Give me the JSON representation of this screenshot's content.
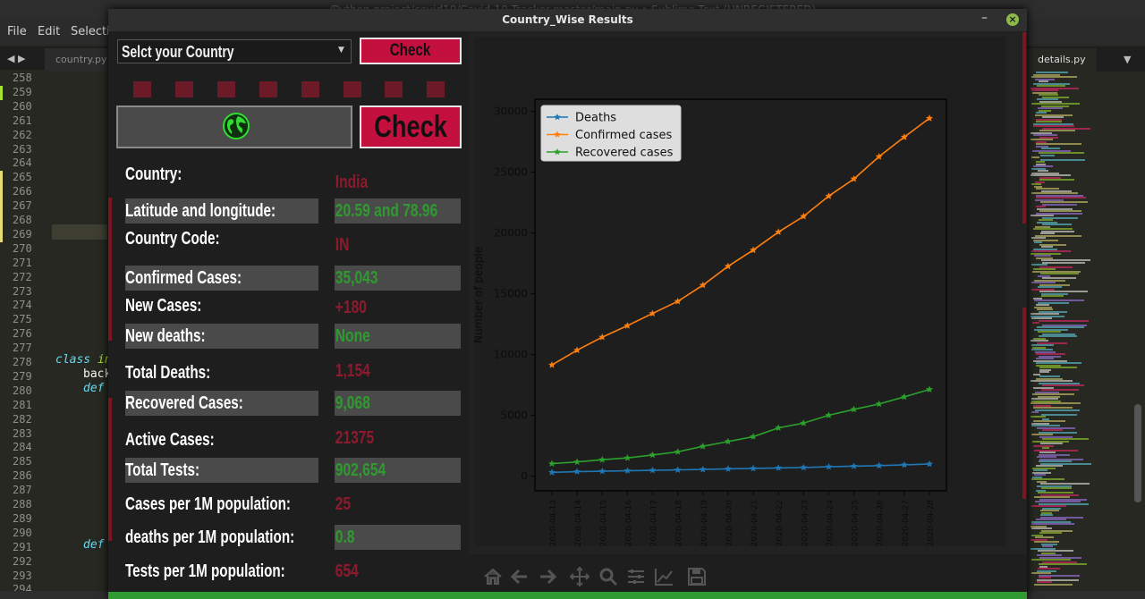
{
  "editor": {
    "title": "/Python project/covid19/Covid-19 Tracker-master/main.py • Sublime Text (UNREGISTERED)",
    "menu": [
      "File",
      "Edit",
      "Selection"
    ],
    "tabs": {
      "left": "country.py",
      "right": "details.py"
    },
    "line_numbers": [
      "258",
      "259",
      "260",
      "261",
      "262",
      "263",
      "264",
      "265",
      "266",
      "267",
      "268",
      "269",
      "270",
      "271",
      "272",
      "273",
      "274",
      "275",
      "276",
      "277",
      "278",
      "279",
      "280",
      "281",
      "282",
      "283",
      "284",
      "285",
      "286",
      "287",
      "288",
      "289",
      "290",
      "291",
      "292",
      "293",
      "294"
    ],
    "code_snippets": {
      "class_kw": "class ",
      "class_rest": "in",
      "back": "back",
      "def1": "def",
      "def2": "def"
    }
  },
  "window": {
    "title": "Country_Wise Results",
    "minimize": "–",
    "close": "×"
  },
  "controls": {
    "select_label": "Selct your Country",
    "check_small": "Check",
    "check_big": "Check"
  },
  "stats": {
    "country_label": "Country:",
    "country_value": "India",
    "latlon_label": "Latitude and longitude:",
    "latlon_value": "20.59 and 78.96",
    "code_label": "Country Code:",
    "code_value": "IN",
    "confirmed_label": "Confirmed Cases:",
    "confirmed_value": "35,043",
    "new_cases_label": "New Cases:",
    "new_cases_value": "+180",
    "new_deaths_label": "New deaths:",
    "new_deaths_value": "None",
    "total_deaths_label": "Total Deaths:",
    "total_deaths_value": "1,154",
    "recovered_label": "Recovered Cases:",
    "recovered_value": "9,068",
    "active_label": "Active Cases:",
    "active_value": "21375",
    "tests_label": "Total Tests:",
    "tests_value": "902,654",
    "cases_per_m_label": "Cases per 1M population:",
    "cases_per_m_value": "25",
    "deaths_per_m_label": "deaths per 1M population:",
    "deaths_per_m_value": "0.8",
    "tests_per_m_label": "Tests per 1M population:",
    "tests_per_m_value": "654"
  },
  "colors": {
    "accent_red": "#c4103f",
    "value_red": "#8e1a2e",
    "value_green": "#2f9a2f",
    "deaths": "#1f77b4",
    "confirmed": "#ff7f0e",
    "recovered": "#2ca02c"
  },
  "toolbar_icons": [
    "home-icon",
    "back-icon",
    "forward-icon",
    "pan-icon",
    "zoom-icon",
    "subplots-icon",
    "edit-axis-icon",
    "save-icon"
  ],
  "chart_data": {
    "type": "line",
    "ylabel": "Number of people",
    "x": [
      "2020-04-13",
      "2020-04-14",
      "2020-04-15",
      "2020-04-16",
      "2020-04-17",
      "2020-04-18",
      "2020-04-19",
      "2020-04-20",
      "2020-04-21",
      "2020-04-22",
      "2020-04-23",
      "2020-04-24",
      "2020-04-25",
      "2020-04-26",
      "2020-04-27",
      "2020-04-28"
    ],
    "ylim": [
      -1200,
      31000
    ],
    "yticks": [
      0,
      5000,
      10000,
      15000,
      20000,
      25000,
      30000
    ],
    "legend_position": "top-left",
    "series": [
      {
        "name": "Deaths",
        "color": "#1f77b4",
        "values": [
          324,
          377,
          414,
          452,
          488,
          521,
          559,
          603,
          640,
          681,
          718,
          779,
          825,
          872,
          934,
          1007
        ]
      },
      {
        "name": "Confirmed cases",
        "color": "#ff7f0e",
        "values": [
          9152,
          10363,
          11438,
          12380,
          13387,
          14378,
          15712,
          17265,
          18600,
          20080,
          21370,
          23039,
          24447,
          26283,
          27890,
          29435
        ]
      },
      {
        "name": "Recovered cases",
        "color": "#2ca02c",
        "values": [
          1035,
          1174,
          1356,
          1505,
          1745,
          2004,
          2463,
          2854,
          3252,
          3975,
          4370,
          5012,
          5496,
          5939,
          6523,
          7137
        ]
      }
    ]
  }
}
